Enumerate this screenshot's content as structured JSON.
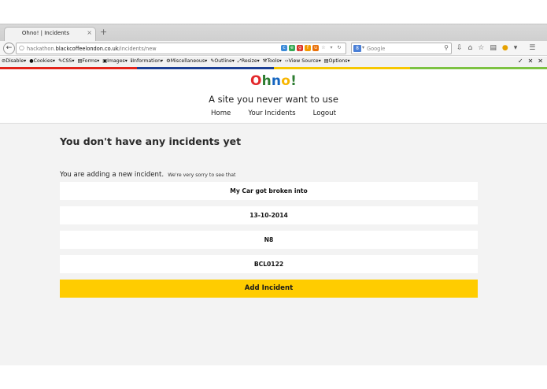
{
  "browser": {
    "tab_title": "Ohno! | Incidents",
    "tab_close": "×",
    "new_tab": "+",
    "url_prefix": "hackathon.",
    "url_host": "blackcoffeelondon.co.uk",
    "url_path": "/incidents/new",
    "search_engine": "8",
    "search_placeholder": "Google",
    "webdev_items": [
      "Disable",
      "Cookies",
      "CSS",
      "Forms",
      "Images",
      "Information",
      "Miscellaneous",
      "Outline",
      "Resize",
      "Tools",
      "View Source",
      "Options"
    ],
    "stripe_colors": [
      "#e2231a",
      "#1c3f94",
      "#f6c700",
      "#7cc242"
    ]
  },
  "site": {
    "logo_letters": [
      {
        "char": "O",
        "color": "#e3282b"
      },
      {
        "char": "h",
        "color": "#2e7d32"
      },
      {
        "char": "n",
        "color": "#1565c0"
      },
      {
        "char": "o",
        "color": "#f7b500"
      },
      {
        "char": "!",
        "color": "#2e7d32"
      }
    ],
    "tagline": "A site you never want to use",
    "nav": [
      "Home",
      "Your Incidents",
      "Logout"
    ]
  },
  "main": {
    "heading": "You don't have any incidents yet",
    "sub_main": "You are adding a new incident.",
    "sub_small": "We're very sorry to see that",
    "fields": [
      {
        "name": "description",
        "value": "My Car got broken into"
      },
      {
        "name": "date",
        "value": "13-10-2014"
      },
      {
        "name": "postcode",
        "value": "N8"
      },
      {
        "name": "reference",
        "value": "BCL0122"
      }
    ],
    "submit_label": "Add Incident",
    "accent": "#ffcc00"
  }
}
